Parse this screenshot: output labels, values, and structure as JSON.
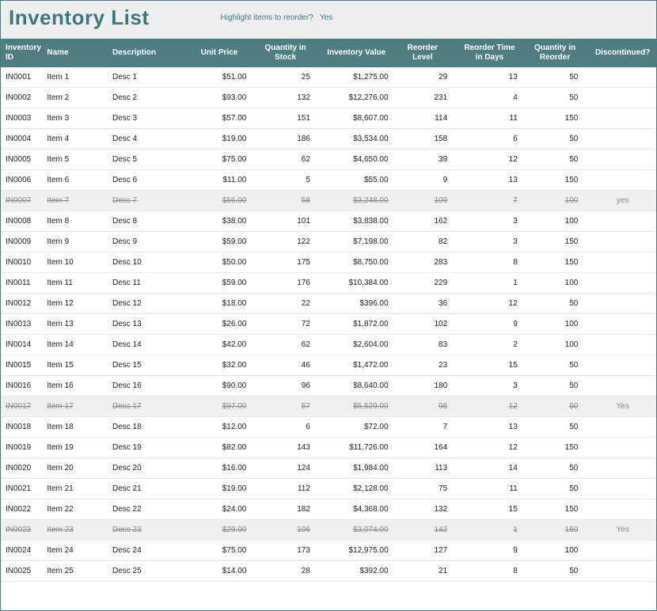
{
  "header": {
    "title": "Inventory List",
    "highlight_label": "Highlight items to reorder?",
    "highlight_value": "Yes"
  },
  "columns": [
    "Inventory ID",
    "Name",
    "Description",
    "Unit Price",
    "Quantity in Stock",
    "Inventory Value",
    "Reorder Level",
    "Reorder Time in Days",
    "Quantity in Reorder",
    "Discontinued?"
  ],
  "rows": [
    {
      "id": "IN0001",
      "name": "Item 1",
      "desc": "Desc 1",
      "price": "$51.00",
      "qstk": "25",
      "val": "$1,275.00",
      "reo": "29",
      "days": "13",
      "qreo": "50",
      "disc": ""
    },
    {
      "id": "IN0002",
      "name": "Item 2",
      "desc": "Desc 2",
      "price": "$93.00",
      "qstk": "132",
      "val": "$12,276.00",
      "reo": "231",
      "days": "4",
      "qreo": "50",
      "disc": ""
    },
    {
      "id": "IN0003",
      "name": "Item 3",
      "desc": "Desc 3",
      "price": "$57.00",
      "qstk": "151",
      "val": "$8,607.00",
      "reo": "114",
      "days": "11",
      "qreo": "150",
      "disc": ""
    },
    {
      "id": "IN0004",
      "name": "Item 4",
      "desc": "Desc 4",
      "price": "$19.00",
      "qstk": "186",
      "val": "$3,534.00",
      "reo": "158",
      "days": "6",
      "qreo": "50",
      "disc": ""
    },
    {
      "id": "IN0005",
      "name": "Item 5",
      "desc": "Desc 5",
      "price": "$75.00",
      "qstk": "62",
      "val": "$4,650.00",
      "reo": "39",
      "days": "12",
      "qreo": "50",
      "disc": ""
    },
    {
      "id": "IN0006",
      "name": "Item 6",
      "desc": "Desc 6",
      "price": "$11.00",
      "qstk": "5",
      "val": "$55.00",
      "reo": "9",
      "days": "13",
      "qreo": "150",
      "disc": ""
    },
    {
      "id": "IN0007",
      "name": "Item 7",
      "desc": "Desc 7",
      "price": "$56.00",
      "qstk": "58",
      "val": "$3,248.00",
      "reo": "109",
      "days": "7",
      "qreo": "100",
      "disc": "yes"
    },
    {
      "id": "IN0008",
      "name": "Item 8",
      "desc": "Desc 8",
      "price": "$38.00",
      "qstk": "101",
      "val": "$3,838.00",
      "reo": "162",
      "days": "3",
      "qreo": "100",
      "disc": ""
    },
    {
      "id": "IN0009",
      "name": "Item 9",
      "desc": "Desc 9",
      "price": "$59.00",
      "qstk": "122",
      "val": "$7,198.00",
      "reo": "82",
      "days": "3",
      "qreo": "150",
      "disc": ""
    },
    {
      "id": "IN0010",
      "name": "Item 10",
      "desc": "Desc 10",
      "price": "$50.00",
      "qstk": "175",
      "val": "$8,750.00",
      "reo": "283",
      "days": "8",
      "qreo": "150",
      "disc": ""
    },
    {
      "id": "IN0011",
      "name": "Item 11",
      "desc": "Desc 11",
      "price": "$59.00",
      "qstk": "176",
      "val": "$10,384.00",
      "reo": "229",
      "days": "1",
      "qreo": "100",
      "disc": ""
    },
    {
      "id": "IN0012",
      "name": "Item 12",
      "desc": "Desc 12",
      "price": "$18.00",
      "qstk": "22",
      "val": "$396.00",
      "reo": "36",
      "days": "12",
      "qreo": "50",
      "disc": ""
    },
    {
      "id": "IN0013",
      "name": "Item 13",
      "desc": "Desc 13",
      "price": "$26.00",
      "qstk": "72",
      "val": "$1,872.00",
      "reo": "102",
      "days": "9",
      "qreo": "100",
      "disc": ""
    },
    {
      "id": "IN0014",
      "name": "Item 14",
      "desc": "Desc 14",
      "price": "$42.00",
      "qstk": "62",
      "val": "$2,604.00",
      "reo": "83",
      "days": "2",
      "qreo": "100",
      "disc": ""
    },
    {
      "id": "IN0015",
      "name": "Item 15",
      "desc": "Desc 15",
      "price": "$32.00",
      "qstk": "46",
      "val": "$1,472.00",
      "reo": "23",
      "days": "15",
      "qreo": "50",
      "disc": ""
    },
    {
      "id": "IN0016",
      "name": "Item 16",
      "desc": "Desc 16",
      "price": "$90.00",
      "qstk": "96",
      "val": "$8,640.00",
      "reo": "180",
      "days": "3",
      "qreo": "50",
      "disc": ""
    },
    {
      "id": "IN0017",
      "name": "Item 17",
      "desc": "Desc 17",
      "price": "$97.00",
      "qstk": "57",
      "val": "$5,529.00",
      "reo": "98",
      "days": "12",
      "qreo": "50",
      "disc": "Yes"
    },
    {
      "id": "IN0018",
      "name": "Item 18",
      "desc": "Desc 18",
      "price": "$12.00",
      "qstk": "6",
      "val": "$72.00",
      "reo": "7",
      "days": "13",
      "qreo": "50",
      "disc": ""
    },
    {
      "id": "IN0019",
      "name": "Item 19",
      "desc": "Desc 19",
      "price": "$82.00",
      "qstk": "143",
      "val": "$11,726.00",
      "reo": "164",
      "days": "12",
      "qreo": "150",
      "disc": ""
    },
    {
      "id": "IN0020",
      "name": "Item 20",
      "desc": "Desc 20",
      "price": "$16.00",
      "qstk": "124",
      "val": "$1,984.00",
      "reo": "113",
      "days": "14",
      "qreo": "50",
      "disc": ""
    },
    {
      "id": "IN0021",
      "name": "Item 21",
      "desc": "Desc 21",
      "price": "$19.00",
      "qstk": "112",
      "val": "$2,128.00",
      "reo": "75",
      "days": "11",
      "qreo": "50",
      "disc": ""
    },
    {
      "id": "IN0022",
      "name": "Item 22",
      "desc": "Desc 22",
      "price": "$24.00",
      "qstk": "182",
      "val": "$4,368.00",
      "reo": "132",
      "days": "15",
      "qreo": "150",
      "disc": ""
    },
    {
      "id": "IN0023",
      "name": "Item 23",
      "desc": "Desc 23",
      "price": "$29.00",
      "qstk": "106",
      "val": "$3,074.00",
      "reo": "142",
      "days": "1",
      "qreo": "150",
      "disc": "Yes"
    },
    {
      "id": "IN0024",
      "name": "Item 24",
      "desc": "Desc 24",
      "price": "$75.00",
      "qstk": "173",
      "val": "$12,975.00",
      "reo": "127",
      "days": "9",
      "qreo": "100",
      "disc": ""
    },
    {
      "id": "IN0025",
      "name": "Item 25",
      "desc": "Desc 25",
      "price": "$14.00",
      "qstk": "28",
      "val": "$392.00",
      "reo": "21",
      "days": "8",
      "qreo": "50",
      "disc": ""
    }
  ]
}
